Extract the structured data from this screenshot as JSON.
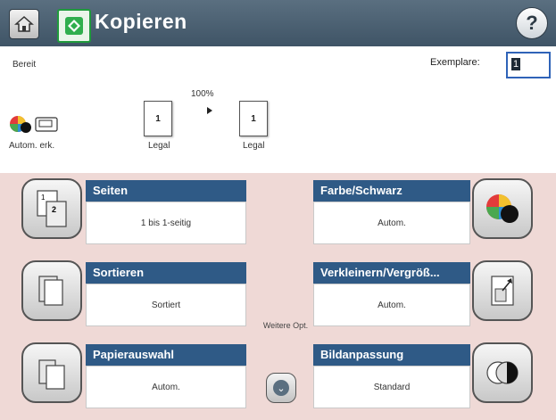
{
  "header": {
    "title": "Kopieren"
  },
  "status": {
    "ready": "Bereit",
    "copies_label": "Exemplare:",
    "copies_value": "1",
    "color_mode_label": "Autom. erk.",
    "zoom": "100%",
    "original": {
      "pages": "1",
      "paper": "Legal"
    },
    "output": {
      "pages": "1",
      "paper": "Legal"
    }
  },
  "tiles": {
    "pages": {
      "title": "Seiten",
      "value": "1 bis 1-seitig"
    },
    "color": {
      "title": "Farbe/Schwarz",
      "value": "Autom."
    },
    "collate": {
      "title": "Sortieren",
      "value": "Sortiert"
    },
    "reduce_enlarge": {
      "title": "Verkleinern/Vergröß...",
      "value": "Autom."
    },
    "paper": {
      "title": "Papierauswahl",
      "value": "Autom."
    },
    "image_adjust": {
      "title": "Bildanpassung",
      "value": "Standard"
    }
  },
  "more_options": {
    "label": "Weitere Opt."
  },
  "colors": {
    "header": "#4a6072",
    "tile_header": "#2f5a86",
    "panel_bg": "#efd9d6"
  }
}
